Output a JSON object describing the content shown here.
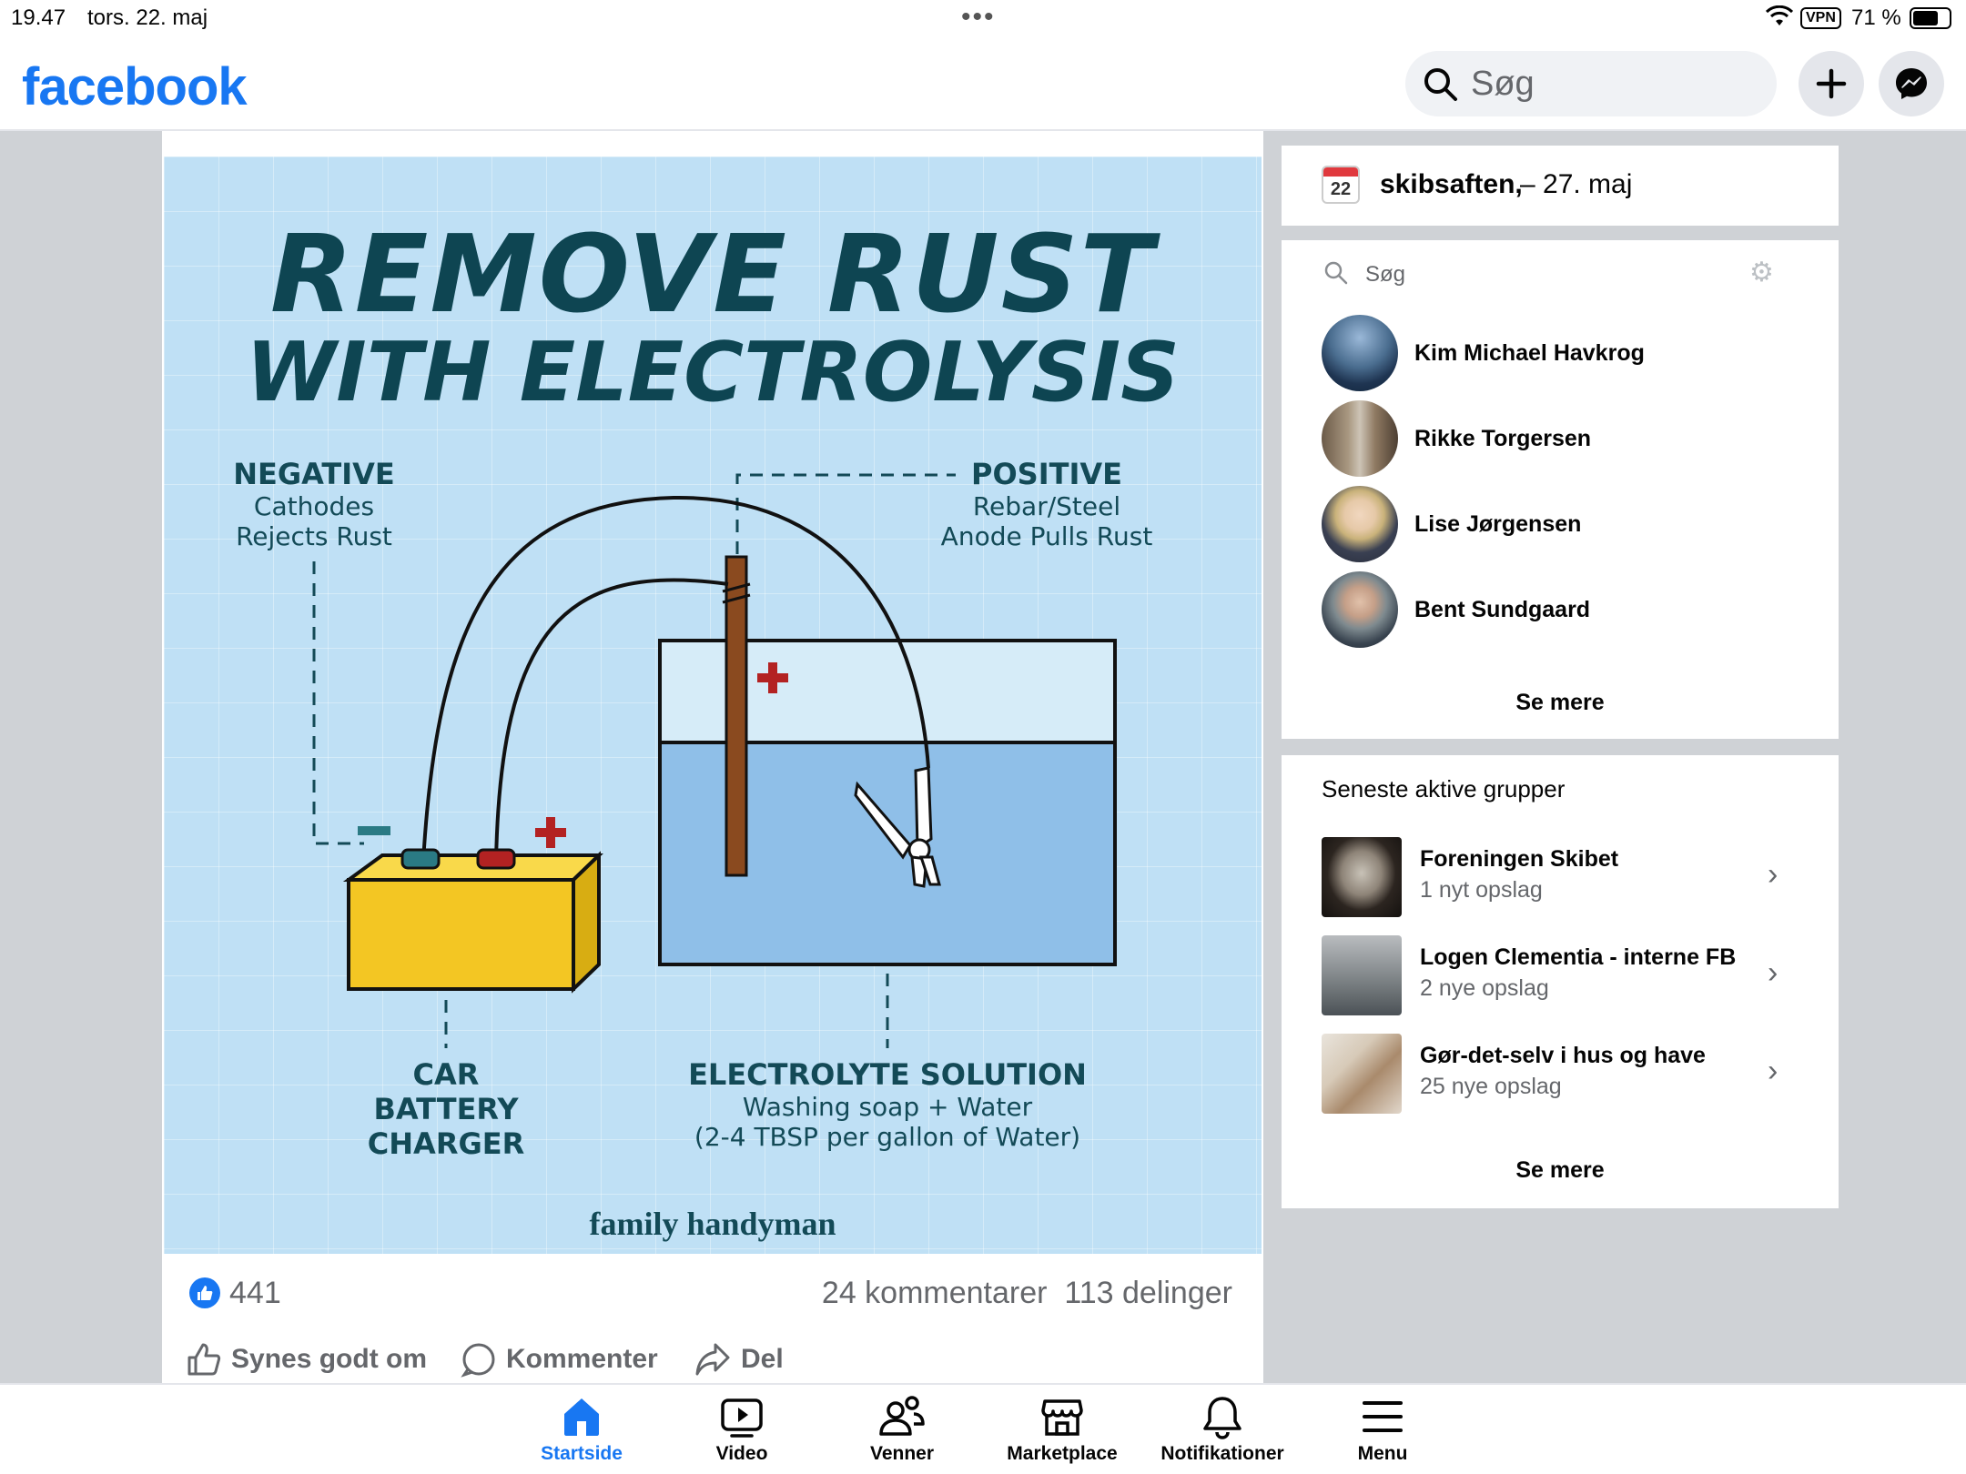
{
  "status_bar": {
    "time": "19.47",
    "date": "tors. 22. maj",
    "vpn": "VPN",
    "battery": "71 %",
    "battery_level": 0.71
  },
  "topnav": {
    "logo": "facebook",
    "search_placeholder": "Søg"
  },
  "post": {
    "image": {
      "title_line1": "REMOVE RUST",
      "title_line2": "WITH ELECTROLYSIS",
      "negative_head": "NEGATIVE",
      "negative_sub1": "Cathodes",
      "negative_sub2": "Rejects Rust",
      "positive_head": "POSITIVE",
      "positive_sub1": "Rebar/Steel",
      "positive_sub2": "Anode Pulls Rust",
      "car_line1": "CAR",
      "car_line2": "BATTERY",
      "car_line3": "CHARGER",
      "electrolyte_head": "ELECTROLYTE SOLUTION",
      "electrolyte_sub1": "Washing soap + Water",
      "electrolyte_sub2": "(2-4 TBSP per gallon of Water)",
      "brand": "family handyman"
    },
    "likes": "441",
    "comments": "24 kommentarer",
    "shares": "113 delinger",
    "actions": {
      "like": "Synes godt om",
      "comment": "Kommenter",
      "share": "Del"
    }
  },
  "event": {
    "day": "22",
    "name": "skibsaften,",
    "date": "– 27. maj"
  },
  "contacts": {
    "search_label": "Søg",
    "items": [
      {
        "name": "Kim Michael Havkrog"
      },
      {
        "name": "Rikke Torgersen"
      },
      {
        "name": "Lise Jørgensen"
      },
      {
        "name": "Bent Sundgaard"
      }
    ],
    "see_more": "Se mere"
  },
  "groups": {
    "title": "Seneste aktive grupper",
    "items": [
      {
        "name": "Foreningen Skibet",
        "sub": "1 nyt opslag"
      },
      {
        "name": "Logen Clementia - interne FB",
        "sub": "2 nye opslag"
      },
      {
        "name": "Gør-det-selv i hus og have",
        "sub": "25 nye opslag"
      }
    ],
    "see_more": "Se mere"
  },
  "tabbar": {
    "items": [
      {
        "label": "Startside",
        "icon": "home-icon",
        "active": true
      },
      {
        "label": "Video",
        "icon": "video-icon"
      },
      {
        "label": "Venner",
        "icon": "friends-icon"
      },
      {
        "label": "Marketplace",
        "icon": "marketplace-icon"
      },
      {
        "label": "Notifikationer",
        "icon": "bell-icon"
      },
      {
        "label": "Menu",
        "icon": "menu-icon"
      }
    ]
  },
  "colors": {
    "brand": "#1877f2",
    "image_bg": "#bfe0f5",
    "water": "#8fbfe8",
    "battery": "#f3c623"
  }
}
